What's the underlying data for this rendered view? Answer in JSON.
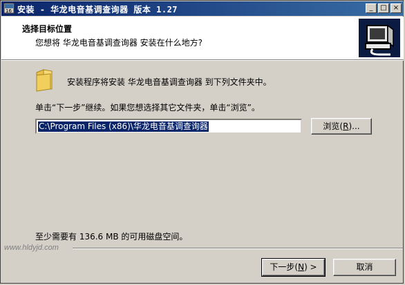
{
  "window": {
    "title": "安装 - 华龙电音基调查询器 版本 1.27",
    "controls": {
      "minimize": "_",
      "maximize": "□",
      "close": "×"
    }
  },
  "header": {
    "title": "选择目标位置",
    "subtitle": "您想将 华龙电音基调查询器 安装在什么地方?"
  },
  "content": {
    "description": "安装程序将安装 华龙电音基调查询器 到下列文件夹中。",
    "hint": "单击“下一步”继续。如果您想选择其它文件夹，单击“浏览”。",
    "install_path": "C:\\Program Files (x86)\\华龙电音基调查询器",
    "browse_button": {
      "label": "浏览",
      "mnemonic": "R",
      "prefix": "(",
      "suffix": ")..."
    },
    "disk_space": "至少需要有 136.6 MB 的可用磁盘空间。"
  },
  "footer": {
    "brand": "www.hldyjd.com",
    "next_button": {
      "label": "下一步",
      "mnemonic": "N",
      "prefix": "(",
      "suffix": ") >"
    },
    "cancel_button": {
      "label": "取消"
    }
  },
  "icons": {
    "app": "setup-app-icon",
    "logo": "computer-install-icon",
    "folder": "folder-icon"
  },
  "colors": {
    "titlebar_start": "#0a246a",
    "titlebar_end": "#3a6ea5",
    "dialog_bg": "#d4d0c8",
    "selection": "#0a246a"
  }
}
